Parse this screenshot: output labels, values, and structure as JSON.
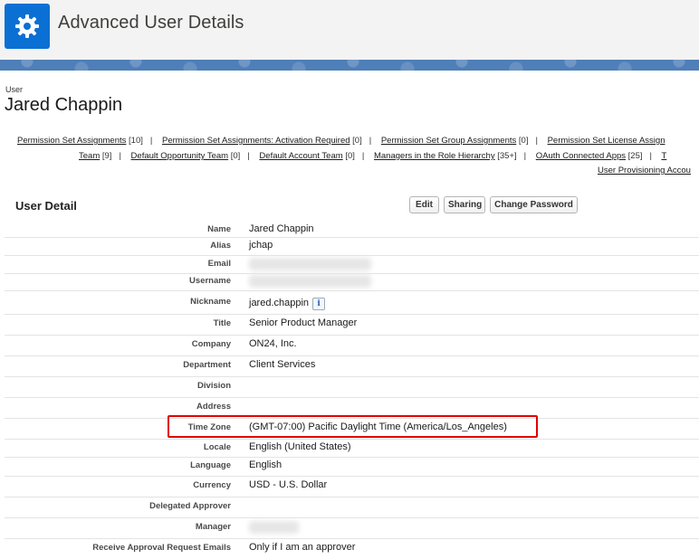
{
  "app": {
    "title": "Advanced User Details",
    "icon": "gear-icon",
    "accent": "#0b70d4"
  },
  "user": {
    "label": "User",
    "name": "Jared Chappin"
  },
  "related_links": {
    "line1": [
      {
        "label": "Permission Set Assignments",
        "count": "[10]"
      },
      {
        "label": "Permission Set Assignments: Activation Required",
        "count": "[0]"
      },
      {
        "label": "Permission Set Group Assignments",
        "count": "[0]"
      },
      {
        "label": "Permission Set License Assign",
        "count": ""
      }
    ],
    "line2": [
      {
        "label": "Team",
        "count": "[9]"
      },
      {
        "label": "Default Opportunity Team",
        "count": "[0]"
      },
      {
        "label": "Default Account Team",
        "count": "[0]"
      },
      {
        "label": "Managers in the Role Hierarchy",
        "count": "[35+]"
      },
      {
        "label": "OAuth Connected Apps",
        "count": "[25]"
      },
      {
        "label": "T",
        "count": ""
      }
    ],
    "line3": [
      {
        "label": "User Provisioning Accou",
        "count": ""
      }
    ]
  },
  "detail": {
    "title": "User Detail",
    "buttons": {
      "edit": "Edit",
      "sharing": "Sharing",
      "change_password": "Change Password"
    },
    "fields": [
      {
        "label": "Name",
        "value": "Jared Chappin"
      },
      {
        "label": "Alias",
        "value": "jchap"
      },
      {
        "label": "Email",
        "value": ""
      },
      {
        "label": "Username",
        "value": ""
      },
      {
        "label": "Nickname",
        "value": "jared.chappin"
      },
      {
        "label": "Title",
        "value": "Senior Product Manager"
      },
      {
        "label": "Company",
        "value": "ON24, Inc."
      },
      {
        "label": "Department",
        "value": "Client Services"
      },
      {
        "label": "Division",
        "value": ""
      },
      {
        "label": "Address",
        "value": ""
      },
      {
        "label": "Time Zone",
        "value": "(GMT-07:00) Pacific Daylight Time (America/Los_Angeles)"
      },
      {
        "label": "Locale",
        "value": "English (United States)"
      },
      {
        "label": "Language",
        "value": "English"
      },
      {
        "label": "Currency",
        "value": "USD - U.S. Dollar"
      },
      {
        "label": "Delegated Approver",
        "value": ""
      },
      {
        "label": "Manager",
        "value": ""
      },
      {
        "label": "Receive Approval Request Emails",
        "value": "Only if I am an approver"
      }
    ],
    "info_icon": "i"
  },
  "highlight_color": "#e00000"
}
